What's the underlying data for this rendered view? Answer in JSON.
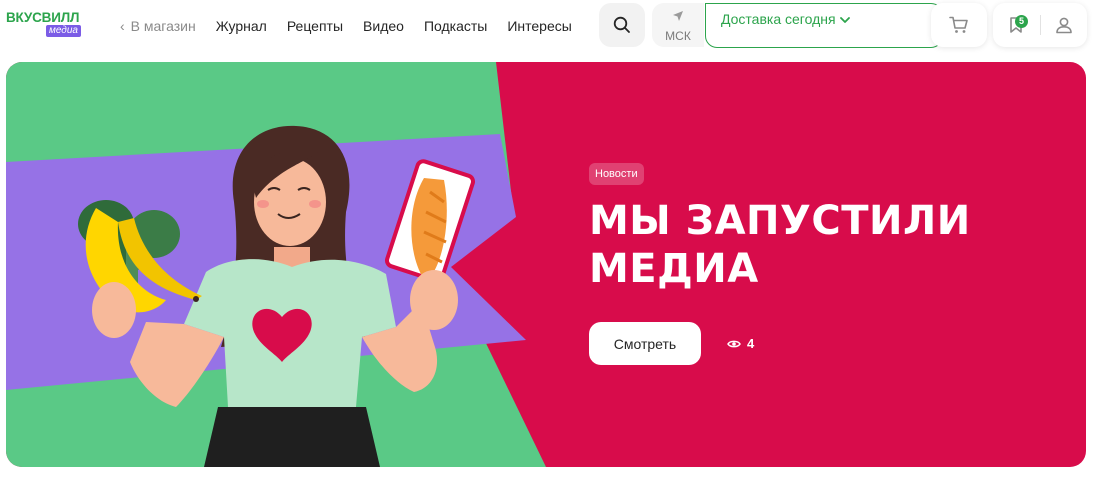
{
  "logo": {
    "main": "ВКУСВИЛЛ",
    "sub": "медиа"
  },
  "nav": {
    "back_label": "В магазин",
    "items": [
      {
        "label": "Журнал"
      },
      {
        "label": "Рецепты"
      },
      {
        "label": "Видео"
      },
      {
        "label": "Подкасты"
      },
      {
        "label": "Интересы"
      }
    ]
  },
  "header": {
    "search_icon": "search-icon",
    "city_label": "МСК",
    "delivery_label": "Доставка сегодня",
    "cart_icon": "cart-icon",
    "favorites_count": "5",
    "profile_icon": "user-icon"
  },
  "hero": {
    "badge": "Новости",
    "title_line1": "Мы запустили",
    "title_line2": "медиа",
    "button_label": "Смотреть",
    "views_count": "4"
  },
  "colors": {
    "brand_green": "#2ca44c",
    "media_purple": "#7b5ce6",
    "hero_red": "#d80c4b",
    "hero_green": "#5ac986",
    "hero_purple": "#9672e6"
  }
}
